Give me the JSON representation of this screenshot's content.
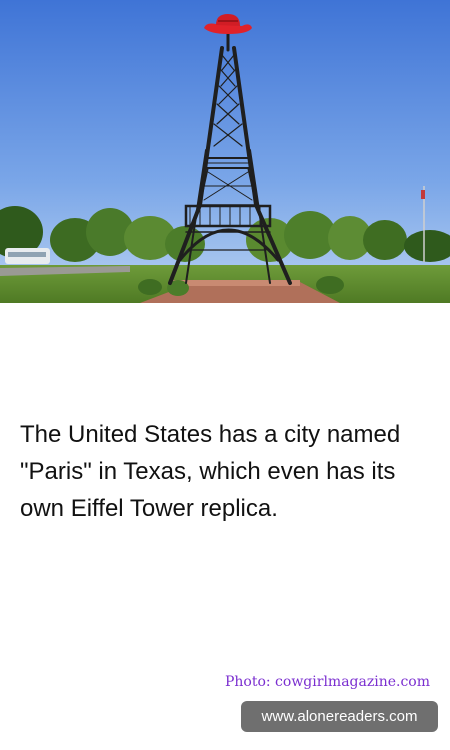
{
  "photo": {
    "subject_icon": "eiffel-tower-with-cowboy-hat-photo"
  },
  "fact": {
    "text": "The United States has a city named \"Paris\" in Texas, which even has its own Eiffel Tower replica."
  },
  "credit": {
    "text": "Photo: cowgirlmagazine.com"
  },
  "watermark": {
    "text": "www.alonereaders.com"
  },
  "colors": {
    "credit": "#7b2fd0",
    "watermark_bg": "#6f6f6f",
    "text": "#111111",
    "sky_top": "#3f74d6",
    "hat": "#e0222a"
  }
}
